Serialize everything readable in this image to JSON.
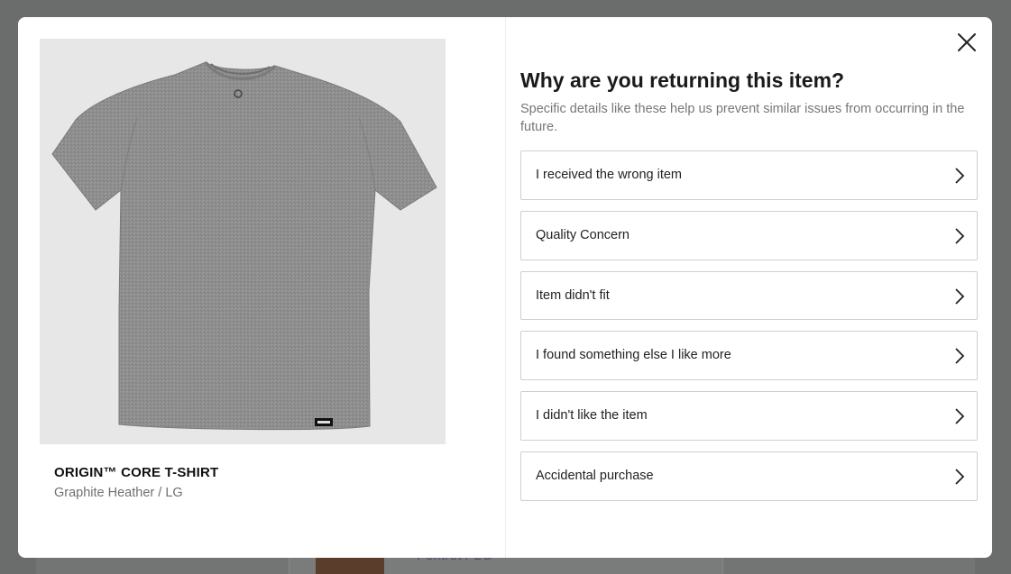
{
  "product": {
    "name": "ORIGIN™ CORE T-SHIRT",
    "variant": "Graphite Heather / LG",
    "image_icon": "tshirt-image"
  },
  "dialog": {
    "title": "Why are you returning this item?",
    "subtitle": "Specific details like these help us prevent similar issues from occurring in the future.",
    "close_icon": "close-icon"
  },
  "reasons": [
    {
      "label": "I received the wrong item"
    },
    {
      "label": "Quality Concern"
    },
    {
      "label": "Item didn't fit"
    },
    {
      "label": "I found something else I like more"
    },
    {
      "label": "I didn't like the item"
    },
    {
      "label": "Accidental purchase"
    }
  ],
  "background": {
    "partial_text": "Foxtrot / LG"
  },
  "colors": {
    "overlay": "#6b6c6c",
    "shirt": "#8d8d8d",
    "image_bg": "#e7e7e7",
    "border": "#cfcfcf"
  }
}
